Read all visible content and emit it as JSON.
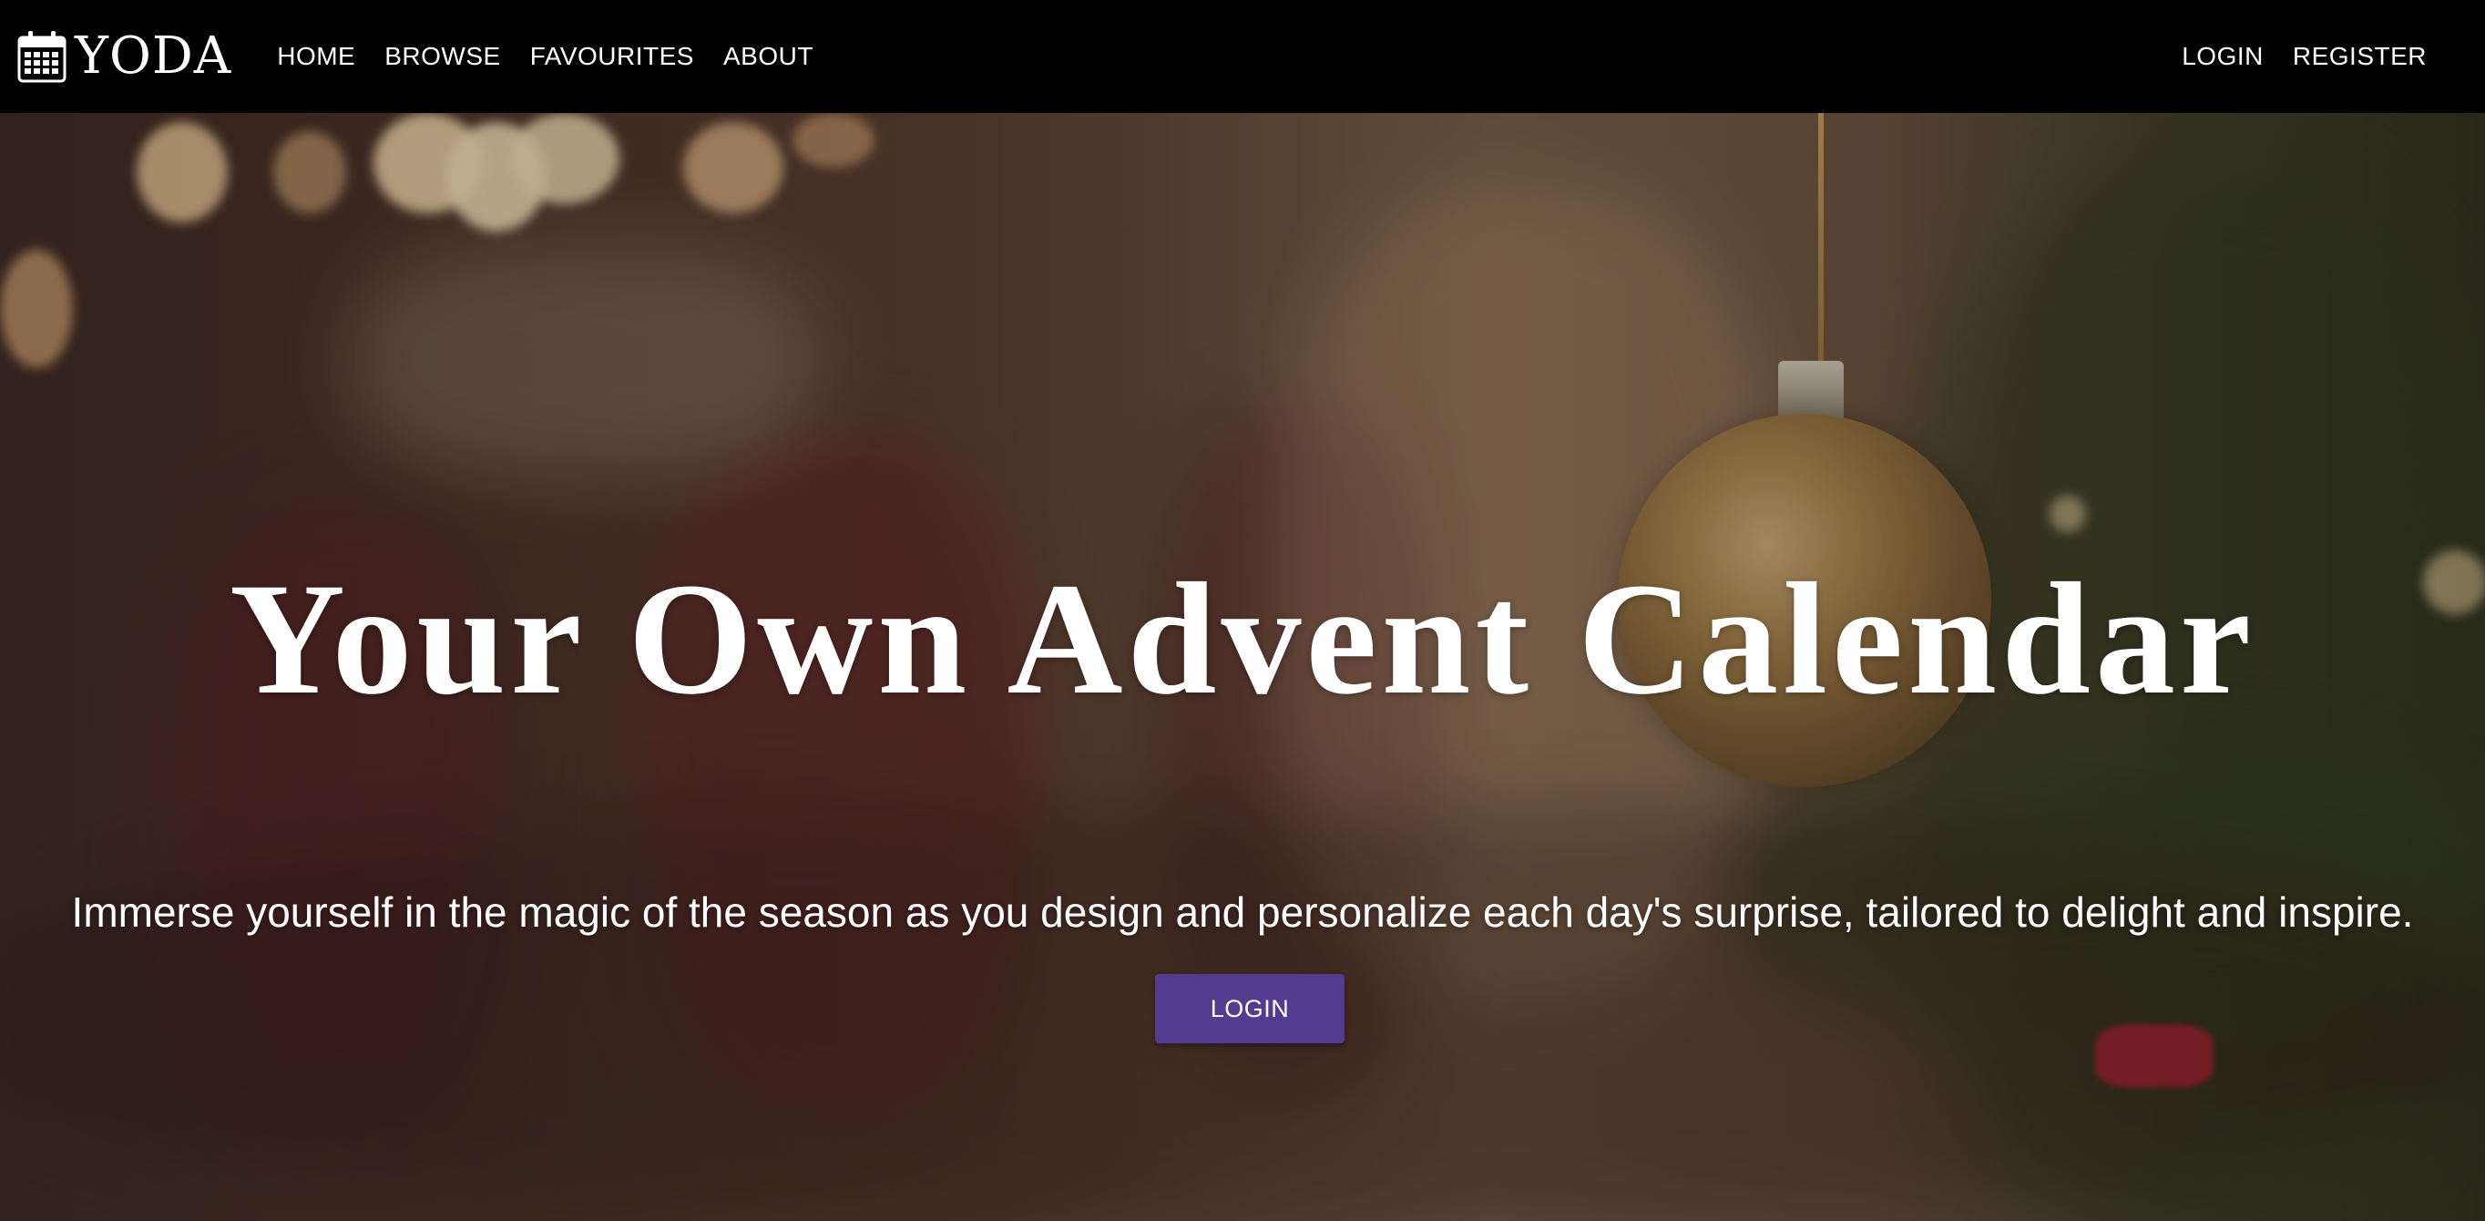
{
  "brand": {
    "name": "YODA",
    "icon": "calendar-icon"
  },
  "nav": {
    "left_links": [
      {
        "label": "HOME"
      },
      {
        "label": "BROWSE"
      },
      {
        "label": "FAVOURITES"
      },
      {
        "label": "ABOUT"
      }
    ],
    "right_links": [
      {
        "label": "LOGIN"
      },
      {
        "label": "REGISTER"
      }
    ]
  },
  "hero": {
    "title": "Your Own Advent Calendar",
    "subtitle": "Immerse yourself in the magic of the season as you design and personalize each day's surprise, tailored to delight and inspire.",
    "button_label": "LOGIN",
    "button_color": "#553b8f",
    "background_image": "blurred-christmas-tree-with-ornament"
  },
  "colors": {
    "navbar_bg": "#000000",
    "text": "#ffffff"
  }
}
